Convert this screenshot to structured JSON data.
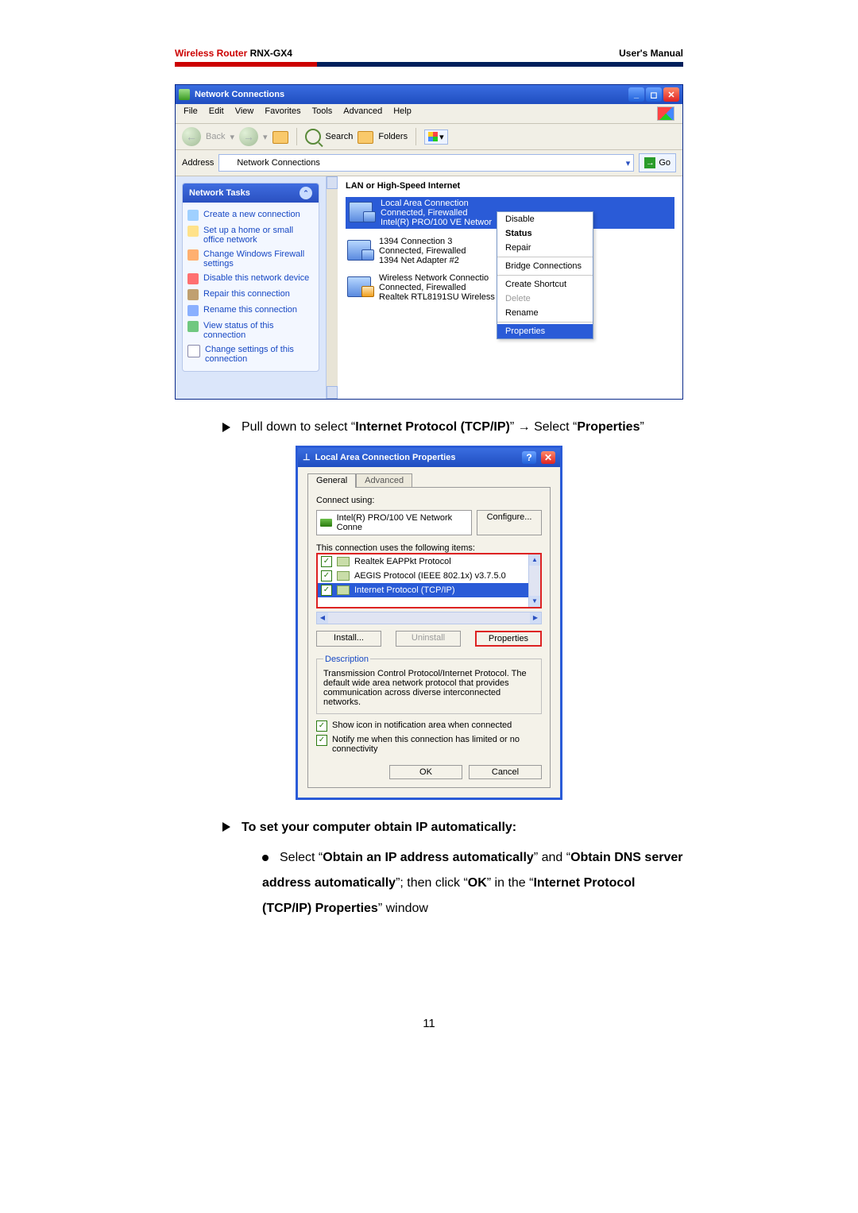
{
  "doc": {
    "header_left_red": "Wireless Router",
    "header_left_model": " RNX-GX4",
    "header_right": "User's Manual",
    "page_number": "11"
  },
  "win1": {
    "title": "Network Connections",
    "menu": [
      "File",
      "Edit",
      "View",
      "Favorites",
      "Tools",
      "Advanced",
      "Help"
    ],
    "toolbar": {
      "back": "Back",
      "search": "Search",
      "folders": "Folders"
    },
    "address_label": "Address",
    "address_value": "Network Connections",
    "go": "Go",
    "tasks_title": "Network Tasks",
    "tasks": [
      "Create a new connection",
      "Set up a home or small office network",
      "Change Windows Firewall settings",
      "Disable this network device",
      "Repair this connection",
      "Rename this connection",
      "View status of this connection",
      "Change settings of this connection"
    ],
    "section_heading": "LAN or High-Speed Internet",
    "conns": [
      {
        "name": "Local Area Connection",
        "status": "Connected, Firewalled",
        "dev": "Intel(R) PRO/100 VE Networ"
      },
      {
        "name": "1394 Connection 3",
        "status": "Connected, Firewalled",
        "dev": "1394 Net Adapter #2"
      },
      {
        "name": "Wireless Network Connectio",
        "status": "Connected, Firewalled",
        "dev": "Realtek RTL8191SU Wireless"
      }
    ],
    "ctx": {
      "disable": "Disable",
      "status": "Status",
      "repair": "Repair",
      "bridge": "Bridge Connections",
      "shortcut": "Create Shortcut",
      "delete": "Delete",
      "rename": "Rename",
      "properties": "Properties"
    }
  },
  "instr1": {
    "pre": "Pull down to select “",
    "bold1": "Internet Protocol (TCP/IP)",
    "mid": "” → Select “",
    "bold2": "Properties",
    "post": "”"
  },
  "dlg": {
    "title": "Local Area Connection Properties",
    "tab_general": "General",
    "tab_advanced": "Advanced",
    "connect_using": "Connect using:",
    "adapter": "Intel(R) PRO/100 VE Network Conne",
    "configure": "Configure...",
    "uses_items": "This connection uses the following items:",
    "items": [
      "Realtek EAPPkt Protocol",
      "AEGIS Protocol (IEEE 802.1x) v3.7.5.0",
      "Internet Protocol (TCP/IP)"
    ],
    "install": "Install...",
    "uninstall": "Uninstall",
    "properties": "Properties",
    "desc_legend": "Description",
    "desc_text": "Transmission Control Protocol/Internet Protocol. The default wide area network protocol that provides communication across diverse interconnected networks.",
    "show_icon": "Show icon in notification area when connected",
    "notify": "Notify me when this connection has limited or no connectivity",
    "ok": "OK",
    "cancel": "Cancel"
  },
  "instr2": {
    "heading": "To set your computer obtain IP automatically:",
    "line_pre": "Select “",
    "b1": "Obtain an IP address automatically",
    "mid1": "” and “",
    "b2": "Obtain DNS server address automatically",
    "mid2": "”; then click “",
    "b3": "OK",
    "mid3": "” in the “",
    "b4": "Internet Protocol (TCP/IP) Properties",
    "post": "” window"
  }
}
